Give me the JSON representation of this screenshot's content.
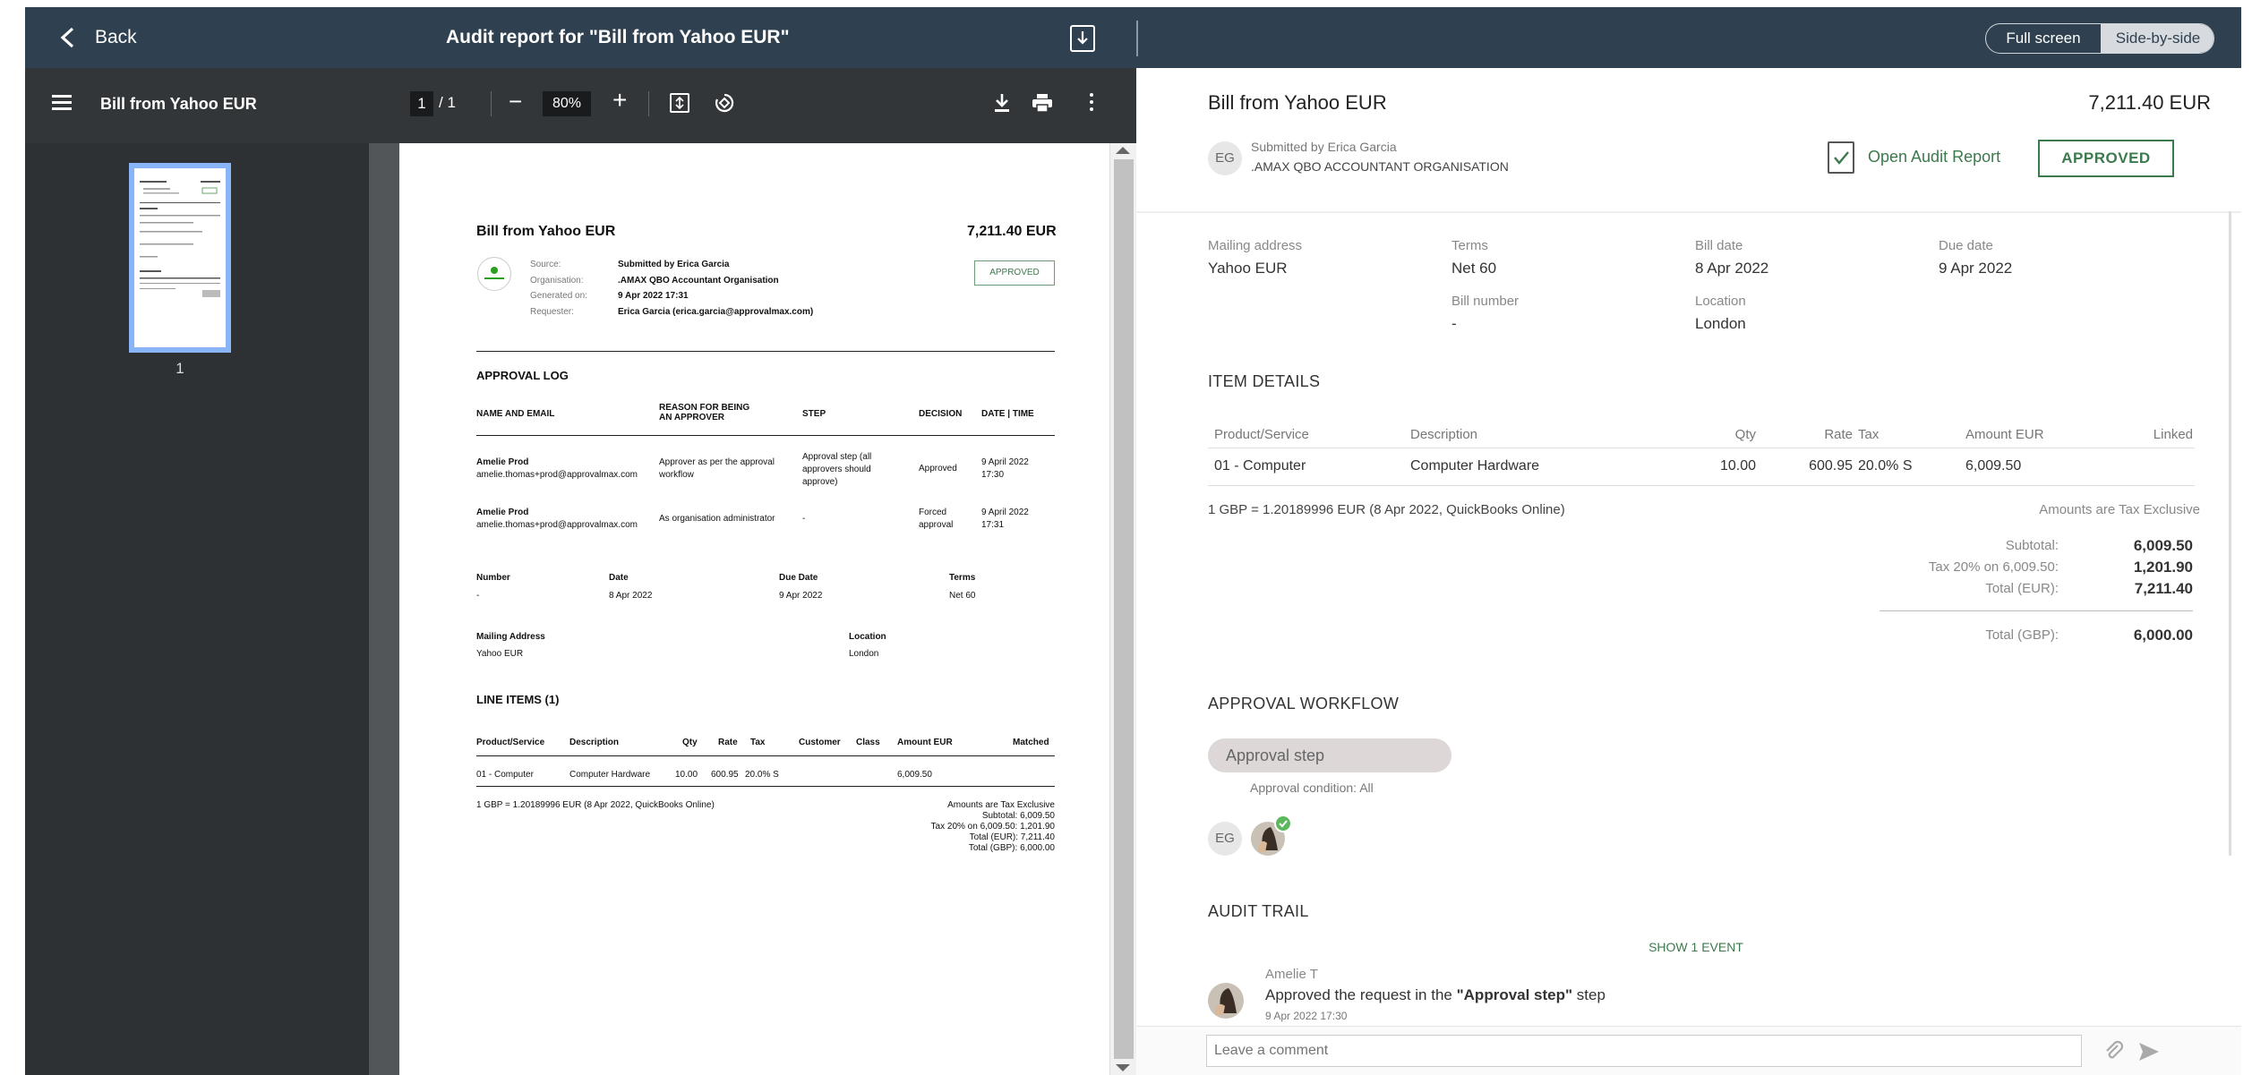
{
  "header": {
    "back": "Back",
    "title": "Audit report for \"Bill from Yahoo EUR\"",
    "full_screen": "Full screen",
    "side_by_side": "Side-by-side"
  },
  "pdf": {
    "doc_name": "Bill from Yahoo EUR",
    "page_current": "1",
    "page_total": "/ 1",
    "zoom": "80%",
    "minus": "−",
    "plus": "+",
    "thumb_page": "1",
    "page": {
      "title": "Bill from Yahoo EUR",
      "amount": "7,211.40 EUR",
      "logo": "QuickBooks",
      "meta_labels": [
        "Source:",
        "Organisation:",
        "Generated on:",
        "Requester:"
      ],
      "meta_values": [
        "Submitted by Erica Garcia",
        ".AMAX QBO Accountant Organisation",
        "9 Apr 2022 17:31",
        "Erica Garcia (erica.garcia@approvalmax.com)"
      ],
      "status": "APPROVED",
      "approval_log": "APPROVAL LOG",
      "log_headers": [
        "NAME AND EMAIL",
        "REASON FOR BEING AN APPROVER",
        "STEP",
        "DECISION",
        "DATE | TIME"
      ],
      "log_rows": [
        {
          "name": "Amelie Prod",
          "email": "amelie.thomas+prod@approvalmax.com",
          "reason": "Approver as per the approval workflow",
          "step": "Approval step (all approvers should approve)",
          "decision": "Approved",
          "date": "9 April 2022 17:30"
        },
        {
          "name": "Amelie Prod",
          "email": "amelie.thomas+prod@approvalmax.com",
          "reason": "As organisation administrator",
          "step": "-",
          "decision": "Forced approval",
          "date": "9 April 2022 17:31"
        }
      ],
      "info_labels": [
        "Number",
        "Date",
        "Due Date",
        "Terms"
      ],
      "info_values": [
        "-",
        "8 Apr 2022",
        "9 Apr 2022",
        "Net 60"
      ],
      "mail_label": "Mailing Address",
      "mail_value": "Yahoo EUR",
      "loc_label": "Location",
      "loc_value": "London",
      "line_items": "LINE ITEMS (1)",
      "li_headers": [
        "Product/Service",
        "Description",
        "Qty",
        "Rate",
        "Tax",
        "Customer",
        "Class",
        "Amount EUR",
        "Matched"
      ],
      "li_row": [
        "01 - Computer",
        "Computer Hardware",
        "10.00",
        "600.95",
        "20.0% S",
        "",
        "",
        "6,009.50",
        ""
      ],
      "fx": "1 GBP = 1.20189996 EUR (8 Apr 2022, QuickBooks Online)",
      "totals": [
        "Amounts are Tax Exclusive",
        "Subtotal: 6,009.50",
        "Tax 20% on 6,009.50: 1,201.90",
        "Total (EUR): 7,211.40",
        "Total (GBP): 6,000.00"
      ]
    }
  },
  "bill": {
    "title": "Bill from Yahoo EUR",
    "amount": "7,211.40 EUR",
    "avatar": "EG",
    "submitted": "Submitted by Erica Garcia",
    "org": ".AMAX QBO ACCOUNTANT ORGANISATION",
    "open_audit": "Open Audit Report",
    "status": "APPROVED",
    "fields": [
      {
        "label": "Mailing address",
        "value": "Yahoo EUR"
      },
      {
        "label": "Terms",
        "value": "Net 60"
      },
      {
        "label": "Bill date",
        "value": "8 Apr 2022"
      },
      {
        "label": "Due date",
        "value": "9 Apr 2022"
      },
      {
        "label": "Bill number",
        "value": "-"
      },
      {
        "label": "Location",
        "value": "London"
      }
    ],
    "item_details": "ITEM DETAILS",
    "item_headers": [
      "Product/Service",
      "Description",
      "Qty",
      "Rate",
      "Tax",
      "Amount EUR",
      "Linked"
    ],
    "item_row": [
      "01 - Computer",
      "Computer Hardware",
      "10.00",
      "600.95",
      "20.0% S",
      "6,009.50",
      ""
    ],
    "fx": "1 GBP = 1.20189996 EUR (8 Apr 2022, QuickBooks Online)",
    "tax_note": "Amounts are Tax Exclusive",
    "totals": [
      {
        "label": "Subtotal:",
        "value": "6,009.50"
      },
      {
        "label": "Tax 20% on 6,009.50:",
        "value": "1,201.90"
      },
      {
        "label": "Total (EUR):",
        "value": "7,211.40"
      },
      {
        "label": "Total (GBP):",
        "value": "6,000.00"
      }
    ],
    "workflow_title": "APPROVAL WORKFLOW",
    "step": "Approval step",
    "condition": "Approval condition: All",
    "audit_title": "AUDIT TRAIL",
    "show_events": "SHOW 1 EVENT",
    "event_user": "Amelie T",
    "event_text_pre": "Approved the request in the ",
    "event_step": "\"Approval step\"",
    "event_text_post": " step",
    "event_time": "9 Apr 2022 17:30",
    "comment_placeholder": "Leave a comment"
  },
  "colors": {
    "header": "#2f4150",
    "approved": "#3c7a4d",
    "check": "#5cb85c"
  }
}
